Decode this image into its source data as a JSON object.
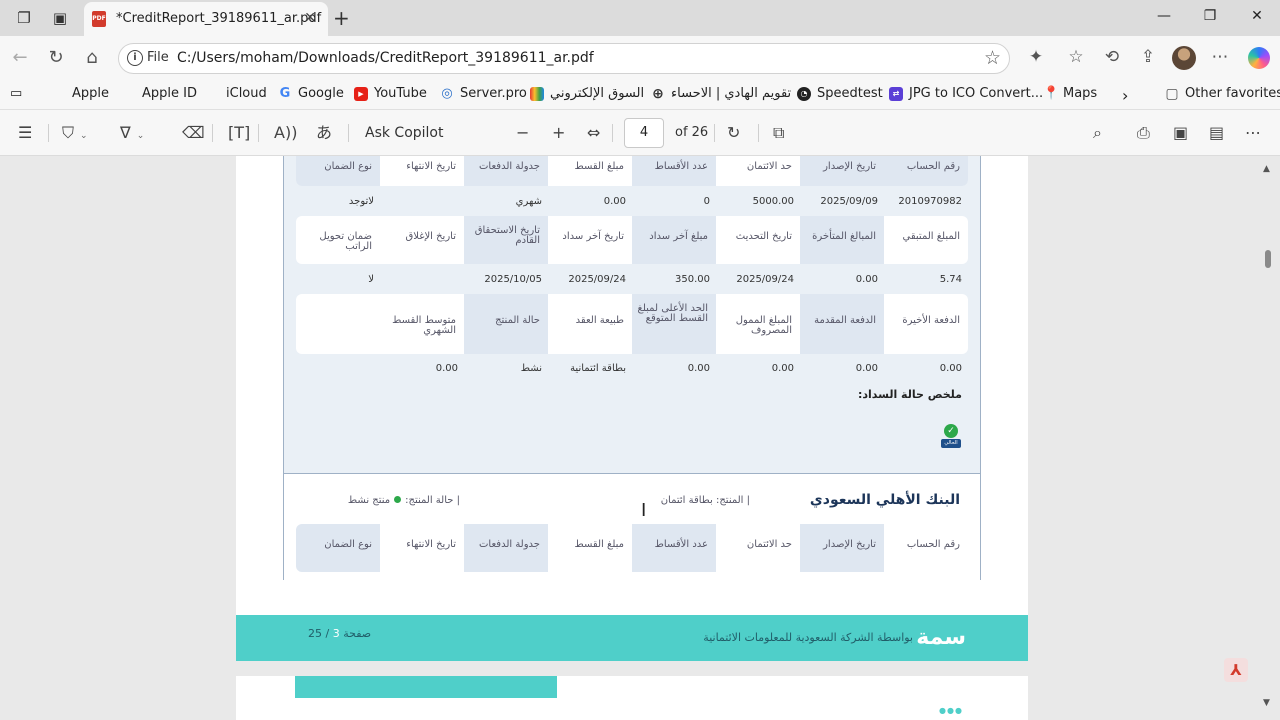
{
  "browser": {
    "tab_title": "*CreditReport_39189611_ar.pdf",
    "address_prefix": "File",
    "url": "C:/Users/moham/Downloads/CreditReport_39189611_ar.pdf"
  },
  "favorites": [
    {
      "label": "Apple",
      "icon": "apple-icon"
    },
    {
      "label": "Apple ID",
      "icon": "apple-icon"
    },
    {
      "label": "iCloud",
      "icon": "apple-icon"
    },
    {
      "label": "Google",
      "icon": "google-icon"
    },
    {
      "label": "YouTube",
      "icon": "youtube-icon"
    },
    {
      "label": "Server.pro",
      "icon": "globe-icon"
    },
    {
      "label": "السوق الإلكتروني",
      "icon": "rainbow-icon"
    },
    {
      "label": "تقويم الهادي | الاحساء",
      "icon": "globe-icon"
    },
    {
      "label": "Speedtest",
      "icon": "speedtest-icon"
    },
    {
      "label": "JPG to ICO Convert...",
      "icon": "converter-icon"
    },
    {
      "label": "Maps",
      "icon": "maps-pin-icon"
    },
    {
      "label": "Other favorites",
      "icon": "folder-icon"
    }
  ],
  "pdf_toolbar": {
    "ask_copilot": "Ask Copilot",
    "page_current": "4",
    "page_total": "of 26"
  },
  "report": {
    "row1_headers": [
      "رقم الحساب",
      "تاريخ الإصدار",
      "حد الائتمان",
      "عدد الأقساط",
      "مبلغ القسط",
      "جدولة الدفعات",
      "تاريخ الانتهاء",
      "نوع الضمان"
    ],
    "row1_values": [
      "2010970982",
      "2025/09/09",
      "5000.00",
      "0",
      "0.00",
      "شهري",
      "",
      "لاتوجد"
    ],
    "row2_headers": [
      "المبلغ المتبقي",
      "المبالغ المتأخرة",
      "تاريخ التحديث",
      "مبلغ آخر سداد",
      "تاريخ آخر سداد",
      "تاريخ الاستحقاق القادم",
      "تاريخ الإغلاق",
      "ضمان تحويل الراتب"
    ],
    "row2_values": [
      "5.74",
      "0.00",
      "2025/09/24",
      "350.00",
      "2025/09/24",
      "2025/10/05",
      "",
      "لا"
    ],
    "row3_headers": [
      "الدفعة الأخيرة",
      "الدفعة المقدمة",
      "المبلغ الممول المصروف",
      "الحد الأعلى لمبلغ القسط المتوقع",
      "طبيعة العقد",
      "حالة المنتج",
      "متوسط القسط الشهري",
      ""
    ],
    "row3_values": [
      "0.00",
      "0.00",
      "0.00",
      "0.00",
      "بطاقة ائتمانية",
      "نشط",
      "0.00",
      ""
    ],
    "summary_label": "ملخص حالة السداد:",
    "badge_label": "الحالي",
    "bank_name": "البنك الأهلي السعودي",
    "product_label": "المنتج: بطاقة ائتمان",
    "status_label": "حالة المنتج:",
    "status_value": "منتج نشط",
    "row4_headers": [
      "رقم الحساب",
      "تاريخ الإصدار",
      "حد الائتمان",
      "عدد الأقساط",
      "مبلغ القسط",
      "جدولة الدفعات",
      "تاريخ الانتهاء",
      "نوع الضمان"
    ],
    "footer_logo": "سمة",
    "footer_text": "بواسطة الشركة السعودية للمعلومات الائتمانية",
    "footer_page_word": "صفحة",
    "footer_page_num": "3",
    "footer_page_total": "/ 25"
  },
  "colors": {
    "teal": "#4fcfc9",
    "highlight": "#dfe7f1",
    "card_bg": "#eaf0f6",
    "bank_name": "#1c3559"
  }
}
